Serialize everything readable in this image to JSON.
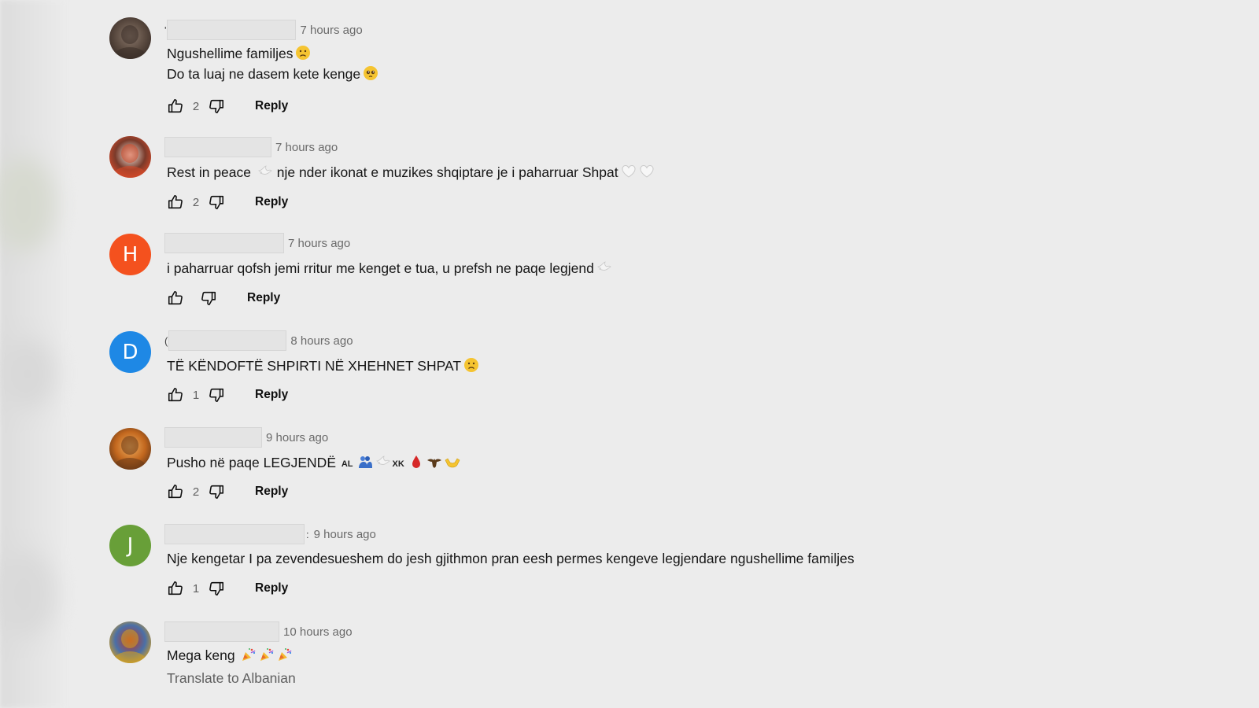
{
  "comments": [
    {
      "avatar": {
        "kind": "photo",
        "colors": [
          "#5a4a40",
          "#3a2e28",
          "#8c7a6c"
        ]
      },
      "name_prefix": "'",
      "time": "7 hours ago",
      "lines": [
        {
          "text": "Ngushellime familjes",
          "emojis": [
            "sad-face"
          ]
        },
        {
          "text": "Do ta luaj ne dasem kete kenge",
          "emojis": [
            "pleading-face"
          ]
        }
      ],
      "likes": "2",
      "reply_label": "Reply"
    },
    {
      "avatar": {
        "kind": "photo",
        "colors": [
          "#7a3a2a",
          "#d44a2a",
          "#f2eee6"
        ]
      },
      "name_prefix": "",
      "time": "7 hours ago",
      "lines": [
        {
          "segments": [
            {
              "text": "Rest in peace "
            },
            {
              "emoji": "dove"
            },
            {
              "text": " nje nder ikonat e muzikes shqiptare je i paharruar Shpat"
            },
            {
              "emoji": "white-heart"
            },
            {
              "emoji": "white-heart"
            }
          ]
        }
      ],
      "likes": "2",
      "reply_label": "Reply"
    },
    {
      "avatar": {
        "kind": "letter",
        "letter": "H",
        "color": "#f4511e"
      },
      "name_prefix": "",
      "time": "7 hours ago",
      "lines": [
        {
          "segments": [
            {
              "text": "i paharruar qofsh jemi rritur me kenget e tua, u prefsh ne paqe legjend"
            },
            {
              "emoji": "dove"
            }
          ]
        }
      ],
      "likes": "",
      "reply_label": "Reply"
    },
    {
      "avatar": {
        "kind": "letter",
        "letter": "D",
        "color": "#1e88e5"
      },
      "name_prefix": "(",
      "time": "8 hours ago",
      "lines": [
        {
          "text": "TË KËNDOFTË SHPIRTI NË XHEHNET SHPAT",
          "emojis": [
            "sad-face"
          ]
        }
      ],
      "likes": "1",
      "reply_label": "Reply"
    },
    {
      "avatar": {
        "kind": "photo",
        "colors": [
          "#c2671e",
          "#6a3a18",
          "#f0b060"
        ]
      },
      "name_prefix": "",
      "time": "9 hours ago",
      "lines": [
        {
          "segments": [
            {
              "text": "Pusho në paqe LEGJENDË "
            },
            {
              "small": "AL"
            },
            {
              "emoji": "people-hugging"
            },
            {
              "emoji": "dove"
            },
            {
              "small": "XK"
            },
            {
              "emoji": "drop-of-blood"
            },
            {
              "emoji": "eagle"
            },
            {
              "emoji": "open-hands"
            }
          ]
        }
      ],
      "likes": "2",
      "reply_label": "Reply"
    },
    {
      "avatar": {
        "kind": "letter",
        "letter": "J",
        "color": "#689f38"
      },
      "name_prefix": "",
      "name_suffix": ":",
      "time": "9 hours ago",
      "lines": [
        {
          "text": "Nje kengetar I pa zevendesueshem do jesh gjithmon pran eesh permes kengeve legjendare ngushellime familjes",
          "emojis": []
        }
      ],
      "likes": "1",
      "reply_label": "Reply"
    },
    {
      "avatar": {
        "kind": "photo",
        "colors": [
          "#4a6fa8",
          "#d4a020",
          "#c03020"
        ]
      },
      "name_prefix": "",
      "time": "10 hours ago",
      "lines": [
        {
          "segments": [
            {
              "text": "Mega keng "
            },
            {
              "emoji": "party-popper"
            },
            {
              "emoji": "party-popper"
            },
            {
              "emoji": "party-popper"
            }
          ]
        }
      ],
      "likes": "",
      "reply_label": "",
      "translate_label": "Translate to Albanian"
    }
  ],
  "icons": {
    "like": "thumbs-up-icon",
    "dislike": "thumbs-down-icon"
  }
}
